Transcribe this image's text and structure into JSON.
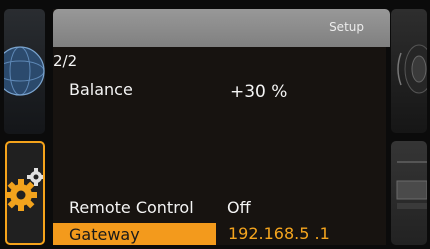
{
  "header": {
    "title": "Setup"
  },
  "page": {
    "indicator": "2/2"
  },
  "settings": [
    {
      "label": "Balance",
      "value": "+30 %"
    },
    {
      "label": "Remote Control",
      "value": "Off"
    },
    {
      "label": "Gateway",
      "value": "192.168.5  .1",
      "selected": true
    }
  ],
  "side_tiles": {
    "left_top_icon": "globe-icon",
    "left_bottom_icon": "gear-icon",
    "right_top_icon": "speaker-icon",
    "right_bottom_icon": "device-icon"
  },
  "colors": {
    "accent": "#f39a1c",
    "header": "#8c8c8c",
    "panel": "#171310"
  }
}
